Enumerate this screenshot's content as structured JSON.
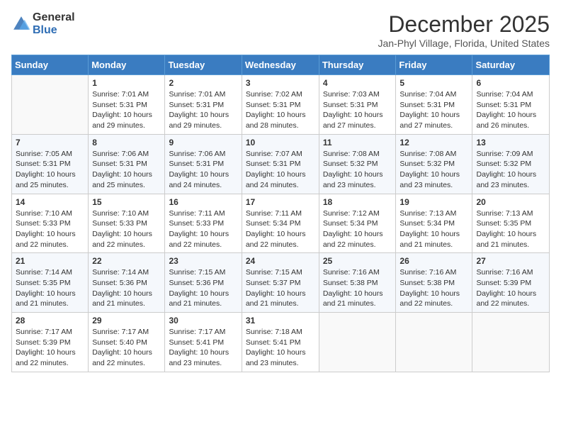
{
  "header": {
    "logo_general": "General",
    "logo_blue": "Blue",
    "month_title": "December 2025",
    "location": "Jan-Phyl Village, Florida, United States"
  },
  "calendar": {
    "days_of_week": [
      "Sunday",
      "Monday",
      "Tuesday",
      "Wednesday",
      "Thursday",
      "Friday",
      "Saturday"
    ],
    "weeks": [
      [
        {
          "day": "",
          "info": ""
        },
        {
          "day": "1",
          "info": "Sunrise: 7:01 AM\nSunset: 5:31 PM\nDaylight: 10 hours\nand 29 minutes."
        },
        {
          "day": "2",
          "info": "Sunrise: 7:01 AM\nSunset: 5:31 PM\nDaylight: 10 hours\nand 29 minutes."
        },
        {
          "day": "3",
          "info": "Sunrise: 7:02 AM\nSunset: 5:31 PM\nDaylight: 10 hours\nand 28 minutes."
        },
        {
          "day": "4",
          "info": "Sunrise: 7:03 AM\nSunset: 5:31 PM\nDaylight: 10 hours\nand 27 minutes."
        },
        {
          "day": "5",
          "info": "Sunrise: 7:04 AM\nSunset: 5:31 PM\nDaylight: 10 hours\nand 27 minutes."
        },
        {
          "day": "6",
          "info": "Sunrise: 7:04 AM\nSunset: 5:31 PM\nDaylight: 10 hours\nand 26 minutes."
        }
      ],
      [
        {
          "day": "7",
          "info": "Sunrise: 7:05 AM\nSunset: 5:31 PM\nDaylight: 10 hours\nand 25 minutes."
        },
        {
          "day": "8",
          "info": "Sunrise: 7:06 AM\nSunset: 5:31 PM\nDaylight: 10 hours\nand 25 minutes."
        },
        {
          "day": "9",
          "info": "Sunrise: 7:06 AM\nSunset: 5:31 PM\nDaylight: 10 hours\nand 24 minutes."
        },
        {
          "day": "10",
          "info": "Sunrise: 7:07 AM\nSunset: 5:31 PM\nDaylight: 10 hours\nand 24 minutes."
        },
        {
          "day": "11",
          "info": "Sunrise: 7:08 AM\nSunset: 5:32 PM\nDaylight: 10 hours\nand 23 minutes."
        },
        {
          "day": "12",
          "info": "Sunrise: 7:08 AM\nSunset: 5:32 PM\nDaylight: 10 hours\nand 23 minutes."
        },
        {
          "day": "13",
          "info": "Sunrise: 7:09 AM\nSunset: 5:32 PM\nDaylight: 10 hours\nand 23 minutes."
        }
      ],
      [
        {
          "day": "14",
          "info": "Sunrise: 7:10 AM\nSunset: 5:33 PM\nDaylight: 10 hours\nand 22 minutes."
        },
        {
          "day": "15",
          "info": "Sunrise: 7:10 AM\nSunset: 5:33 PM\nDaylight: 10 hours\nand 22 minutes."
        },
        {
          "day": "16",
          "info": "Sunrise: 7:11 AM\nSunset: 5:33 PM\nDaylight: 10 hours\nand 22 minutes."
        },
        {
          "day": "17",
          "info": "Sunrise: 7:11 AM\nSunset: 5:34 PM\nDaylight: 10 hours\nand 22 minutes."
        },
        {
          "day": "18",
          "info": "Sunrise: 7:12 AM\nSunset: 5:34 PM\nDaylight: 10 hours\nand 22 minutes."
        },
        {
          "day": "19",
          "info": "Sunrise: 7:13 AM\nSunset: 5:34 PM\nDaylight: 10 hours\nand 21 minutes."
        },
        {
          "day": "20",
          "info": "Sunrise: 7:13 AM\nSunset: 5:35 PM\nDaylight: 10 hours\nand 21 minutes."
        }
      ],
      [
        {
          "day": "21",
          "info": "Sunrise: 7:14 AM\nSunset: 5:35 PM\nDaylight: 10 hours\nand 21 minutes."
        },
        {
          "day": "22",
          "info": "Sunrise: 7:14 AM\nSunset: 5:36 PM\nDaylight: 10 hours\nand 21 minutes."
        },
        {
          "day": "23",
          "info": "Sunrise: 7:15 AM\nSunset: 5:36 PM\nDaylight: 10 hours\nand 21 minutes."
        },
        {
          "day": "24",
          "info": "Sunrise: 7:15 AM\nSunset: 5:37 PM\nDaylight: 10 hours\nand 21 minutes."
        },
        {
          "day": "25",
          "info": "Sunrise: 7:16 AM\nSunset: 5:38 PM\nDaylight: 10 hours\nand 21 minutes."
        },
        {
          "day": "26",
          "info": "Sunrise: 7:16 AM\nSunset: 5:38 PM\nDaylight: 10 hours\nand 22 minutes."
        },
        {
          "day": "27",
          "info": "Sunrise: 7:16 AM\nSunset: 5:39 PM\nDaylight: 10 hours\nand 22 minutes."
        }
      ],
      [
        {
          "day": "28",
          "info": "Sunrise: 7:17 AM\nSunset: 5:39 PM\nDaylight: 10 hours\nand 22 minutes."
        },
        {
          "day": "29",
          "info": "Sunrise: 7:17 AM\nSunset: 5:40 PM\nDaylight: 10 hours\nand 22 minutes."
        },
        {
          "day": "30",
          "info": "Sunrise: 7:17 AM\nSunset: 5:41 PM\nDaylight: 10 hours\nand 23 minutes."
        },
        {
          "day": "31",
          "info": "Sunrise: 7:18 AM\nSunset: 5:41 PM\nDaylight: 10 hours\nand 23 minutes."
        },
        {
          "day": "",
          "info": ""
        },
        {
          "day": "",
          "info": ""
        },
        {
          "day": "",
          "info": ""
        }
      ]
    ]
  }
}
